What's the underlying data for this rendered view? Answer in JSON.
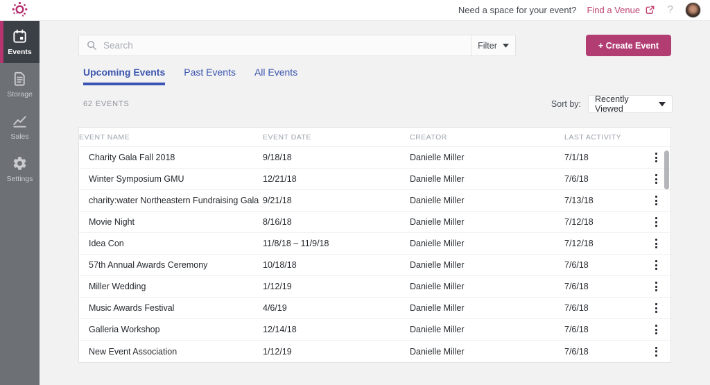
{
  "topbar": {
    "prompt": "Need a space for your event?",
    "venue_link": "Find a Venue",
    "help_label": "?"
  },
  "sidebar": {
    "items": [
      {
        "label": "Events",
        "icon": "calendar-icon",
        "active": true
      },
      {
        "label": "Storage",
        "icon": "document-icon"
      },
      {
        "label": "Sales",
        "icon": "chart-icon"
      },
      {
        "label": "Settings",
        "icon": "gear-icon"
      }
    ]
  },
  "toolbar": {
    "search_placeholder": "Search",
    "filter_label": "Filter",
    "create_label": "+ Create Event"
  },
  "tabs": [
    {
      "label": "Upcoming Events",
      "active": true
    },
    {
      "label": "Past Events"
    },
    {
      "label": "All Events"
    }
  ],
  "list": {
    "count_label": "62 EVENTS",
    "sort_label": "Sort by:",
    "sort_value": "Recently Viewed",
    "columns": [
      "EVENT NAME",
      "EVENT DATE",
      "CREATOR",
      "LAST ACTIVITY"
    ],
    "rows": [
      {
        "name": "Charity Gala Fall 2018",
        "date": "9/18/18",
        "creator": "Danielle Miller",
        "activity": "7/1/18"
      },
      {
        "name": "Winter Symposium GMU",
        "date": "12/21/18",
        "creator": "Danielle Miller",
        "activity": "7/6/18"
      },
      {
        "name": "charity:water Northeastern Fundraising Gala",
        "date": "9/21/18",
        "creator": "Danielle Miller",
        "activity": "7/13/18"
      },
      {
        "name": "Movie Night",
        "date": "8/16/18",
        "creator": "Danielle Miller",
        "activity": "7/12/18"
      },
      {
        "name": "Idea Con",
        "date": "11/8/18 – 11/9/18",
        "creator": "Danielle Miller",
        "activity": "7/12/18"
      },
      {
        "name": "57th Annual Awards Ceremony",
        "date": "10/18/18",
        "creator": "Danielle Miller",
        "activity": "7/6/18"
      },
      {
        "name": "Miller Wedding",
        "date": "1/12/19",
        "creator": "Danielle Miller",
        "activity": "7/6/18"
      },
      {
        "name": "Music Awards Festival",
        "date": "4/6/19",
        "creator": "Danielle Miller",
        "activity": "7/6/18"
      },
      {
        "name": "Galleria Workshop",
        "date": "12/14/18",
        "creator": "Danielle Miller",
        "activity": "7/6/18"
      },
      {
        "name": "New Event Association",
        "date": "1/12/19",
        "creator": "Danielle Miller",
        "activity": "7/6/18"
      }
    ]
  },
  "colors": {
    "accent_magenta": "#b13d73",
    "link_pink": "#bf4170",
    "tab_blue": "#3c55ad",
    "tab_underline": "#3a55b4",
    "sidebar_bg": "#6d7176",
    "sidebar_active_bg": "#3b3f46",
    "sidebar_active_strip": "#b5356f",
    "logo_color": "#b42d6f"
  }
}
